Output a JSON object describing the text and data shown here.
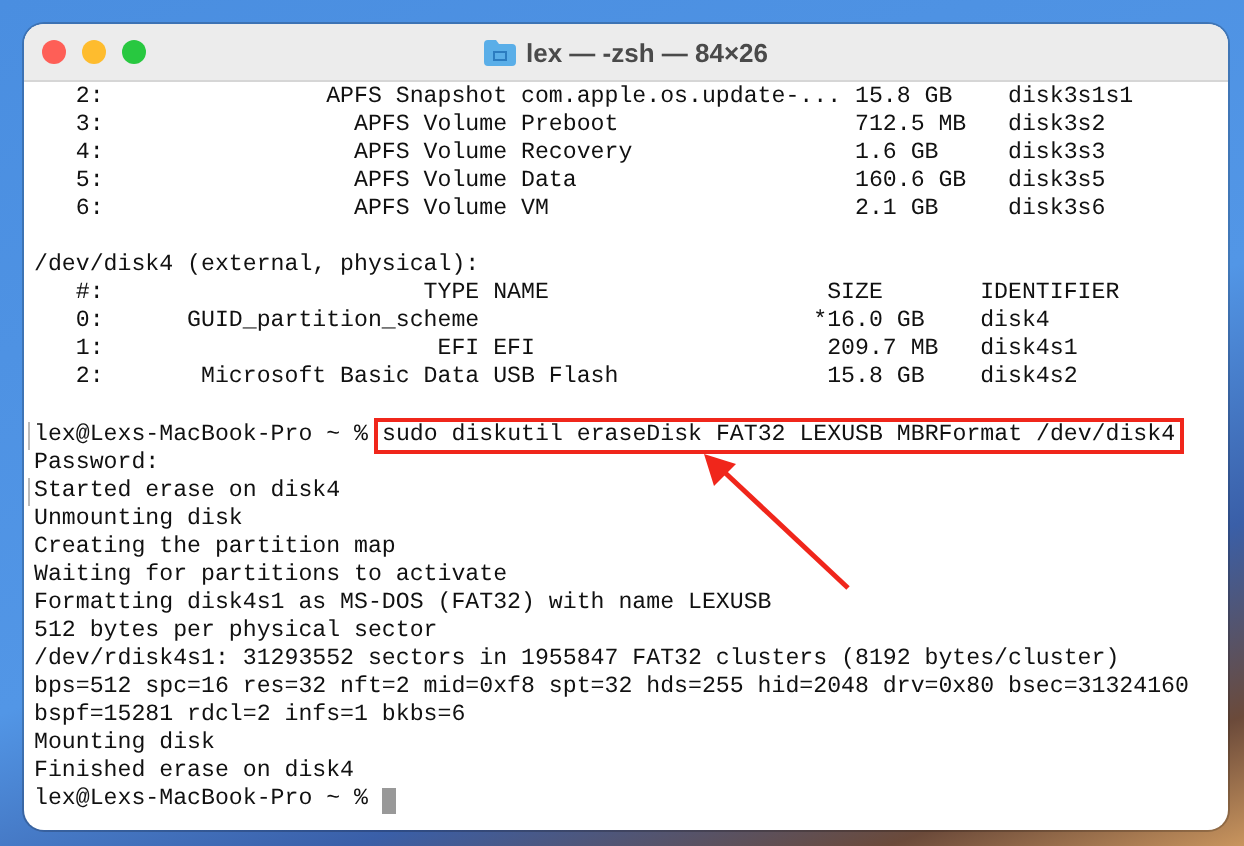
{
  "window": {
    "title": "lex — -zsh — 84×26"
  },
  "lines": [
    {
      "kind": "text",
      "text": "   2:                APFS Snapshot com.apple.os.update-... 15.8 GB    disk3s1s1",
      "marked": false
    },
    {
      "kind": "text",
      "text": "   3:                  APFS Volume Preboot                 712.5 MB   disk3s2",
      "marked": false
    },
    {
      "kind": "text",
      "text": "   4:                  APFS Volume Recovery                1.6 GB     disk3s3",
      "marked": false
    },
    {
      "kind": "text",
      "text": "   5:                  APFS Volume Data                    160.6 GB   disk3s5",
      "marked": false
    },
    {
      "kind": "text",
      "text": "   6:                  APFS Volume VM                      2.1 GB     disk3s6",
      "marked": false
    },
    {
      "kind": "blank"
    },
    {
      "kind": "text",
      "text": "/dev/disk4 (external, physical):",
      "marked": false
    },
    {
      "kind": "text",
      "text": "   #:                       TYPE NAME                    SIZE       IDENTIFIER",
      "marked": false
    },
    {
      "kind": "text",
      "text": "   0:      GUID_partition_scheme                        *16.0 GB    disk4",
      "marked": false
    },
    {
      "kind": "text",
      "text": "   1:                        EFI EFI                     209.7 MB   disk4s1",
      "marked": false
    },
    {
      "kind": "text",
      "text": "   2:       Microsoft Basic Data USB Flash               15.8 GB    disk4s2",
      "marked": false
    },
    {
      "kind": "blank"
    },
    {
      "kind": "prompt",
      "prompt": "lex@Lexs-MacBook-Pro ~ %",
      "command": "sudo diskutil eraseDisk FAT32 LEXUSB MBRFormat /dev/disk4",
      "highlighted": true,
      "cursor": false,
      "marked": true
    },
    {
      "kind": "text",
      "text": "Password:",
      "marked": false
    },
    {
      "kind": "text",
      "text": "Started erase on disk4",
      "marked": true
    },
    {
      "kind": "text",
      "text": "Unmounting disk",
      "marked": false
    },
    {
      "kind": "text",
      "text": "Creating the partition map",
      "marked": false
    },
    {
      "kind": "text",
      "text": "Waiting for partitions to activate",
      "marked": false
    },
    {
      "kind": "text",
      "text": "Formatting disk4s1 as MS-DOS (FAT32) with name LEXUSB",
      "marked": false
    },
    {
      "kind": "text",
      "text": "512 bytes per physical sector",
      "marked": false
    },
    {
      "kind": "text",
      "text": "/dev/rdisk4s1: 31293552 sectors in 1955847 FAT32 clusters (8192 bytes/cluster)",
      "marked": false
    },
    {
      "kind": "text",
      "text": "bps=512 spc=16 res=32 nft=2 mid=0xf8 spt=32 hds=255 hid=2048 drv=0x80 bsec=31324160",
      "marked": false
    },
    {
      "kind": "text",
      "text": "bspf=15281 rdcl=2 infs=1 bkbs=6",
      "marked": false
    },
    {
      "kind": "text",
      "text": "Mounting disk",
      "marked": false
    },
    {
      "kind": "text",
      "text": "Finished erase on disk4",
      "marked": false
    },
    {
      "kind": "prompt",
      "prompt": "lex@Lexs-MacBook-Pro ~ %",
      "cursor": true,
      "marked": false
    }
  ]
}
